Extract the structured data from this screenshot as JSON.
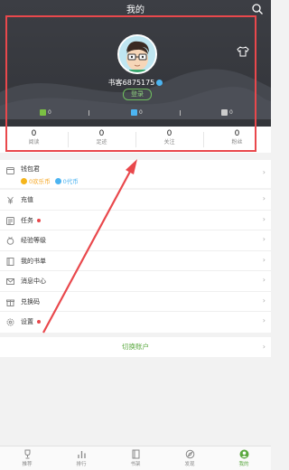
{
  "header": {
    "title": "我的",
    "username": "书客6875175",
    "login_label": "登录"
  },
  "tickets": [
    {
      "icon": "monthly-ticket-icon",
      "value": "0",
      "color": "#7bc043"
    },
    {
      "icon": "recommend-ticket-icon",
      "value": "0",
      "color": "#4cb4f1"
    },
    {
      "icon": "reward-ticket-icon",
      "value": "0",
      "color": "#cccccc"
    }
  ],
  "stats": [
    {
      "value": "0",
      "label": "阅读"
    },
    {
      "value": "0",
      "label": "足迹"
    },
    {
      "value": "0",
      "label": "关注"
    },
    {
      "value": "0",
      "label": "粉丝"
    }
  ],
  "wallet": {
    "title": "钱包君",
    "coins": "0欢乐币",
    "vouchers": "0代币",
    "coin_color": "#f5b51b",
    "voucher_color": "#4cb4f1"
  },
  "menu": [
    {
      "label": "充值",
      "icon": "yen-icon",
      "badge": false
    },
    {
      "label": "任务",
      "icon": "task-list-icon",
      "badge": true
    },
    {
      "label": "经验等级",
      "icon": "medal-icon",
      "badge": false
    },
    {
      "label": "我的书单",
      "icon": "book-list-icon",
      "badge": false
    },
    {
      "label": "消息中心",
      "icon": "mail-icon",
      "badge": false
    },
    {
      "label": "兑换码",
      "icon": "gift-icon",
      "badge": false
    },
    {
      "label": "设置",
      "icon": "gear-icon",
      "badge": true
    }
  ],
  "switch_account": "切换账户",
  "tabs": [
    {
      "label": "推荐",
      "icon": "trophy-icon",
      "active": false
    },
    {
      "label": "排行",
      "icon": "ranking-icon",
      "active": false
    },
    {
      "label": "书架",
      "icon": "bookshelf-icon",
      "active": false
    },
    {
      "label": "发现",
      "icon": "discover-icon",
      "active": false
    },
    {
      "label": "我的",
      "icon": "profile-icon",
      "active": true
    }
  ],
  "colors": {
    "accent": "#5aa83f",
    "highlight": "#e9484c",
    "header_bg": "#3c3e44"
  }
}
